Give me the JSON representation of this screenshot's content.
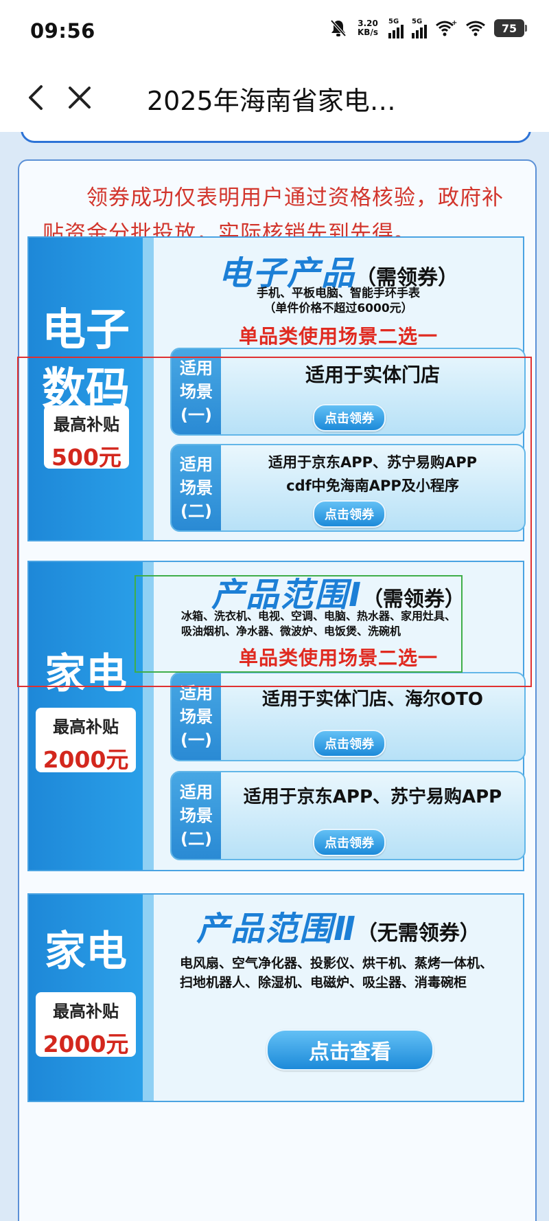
{
  "status_bar": {
    "time": "09:56",
    "net_speed_value": "3.20",
    "net_speed_unit": "KB/s",
    "signal1_label": "5G",
    "signal2_label": "5G",
    "battery": "75"
  },
  "nav": {
    "title": "2025年海南省家电…"
  },
  "notice": "领券成功仅表明用户通过资格核验，政府补贴资金分批投放，实际核销先到先得。",
  "sections": {
    "digital": {
      "side_line1": "电子",
      "side_line2": "数码",
      "subsidy_label": "最高补贴",
      "subsidy_value": "500元",
      "heading": "电子产品",
      "heading_note": "（需领券）",
      "desc_line1": "手机、平板电脑、智能手环手表",
      "desc_line2": "（单件价格不超过6000元）",
      "choose": "单品类使用场景二选一",
      "scene1": {
        "tag1": "适用",
        "tag2": "场景",
        "tag3": "(一)",
        "text": "适用于实体门店",
        "button": "点击领券"
      },
      "scene2": {
        "tag1": "适用",
        "tag2": "场景",
        "tag3": "(二)",
        "text_line1": "适用于京东APP、苏宁易购APP",
        "text_line2": "cdf中免海南APP及小程序",
        "button": "点击领券"
      }
    },
    "appliance1": {
      "side_line1": "家电",
      "subsidy_label": "最高补贴",
      "subsidy_value": "2000元",
      "heading": "产品范围Ⅰ",
      "heading_note": "（需领券）",
      "desc_line1": "冰箱、洗衣机、电视、空调、电脑、热水器、家用灶具、",
      "desc_line2": "吸油烟机、净水器、微波炉、电饭煲、洗碗机",
      "choose": "单品类使用场景二选一",
      "scene1": {
        "tag1": "适用",
        "tag2": "场景",
        "tag3": "(一)",
        "text": "适用于实体门店、海尔OTO",
        "button": "点击领券"
      },
      "scene2": {
        "tag1": "适用",
        "tag2": "场景",
        "tag3": "(二)",
        "text": "适用于京东APP、苏宁易购APP",
        "button": "点击领券"
      }
    },
    "appliance2": {
      "side_line1": "家电",
      "subsidy_label": "最高补贴",
      "subsidy_value": "2000元",
      "heading": "产品范围Ⅱ",
      "heading_note": "（无需领券）",
      "desc_line1": "电风扇、空气净化器、投影仪、烘干机、蒸烤一体机、",
      "desc_line2": "扫地机器人、除湿机、电磁炉、吸尘器、消毒碗柜",
      "button": "点击查看"
    }
  }
}
